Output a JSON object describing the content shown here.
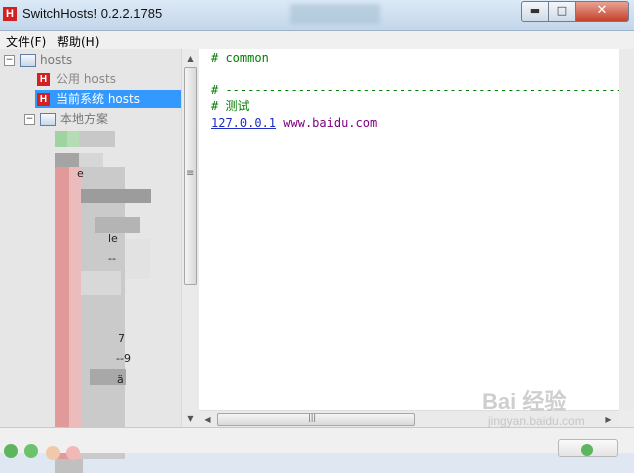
{
  "window": {
    "title": "SwitchHosts! 0.2.2.1785",
    "app_icon_letter": "H",
    "controls": {
      "minimize": "▬",
      "maximize": "□",
      "close": "✕"
    }
  },
  "menu": {
    "file": "文件(F)",
    "help": "帮助(H)"
  },
  "tree": {
    "root_label": "hosts",
    "root_expander": "−",
    "items": [
      {
        "label": "公用 hosts",
        "icon": "hosts-h-icon",
        "state": "normal"
      },
      {
        "label": "当前系统 hosts",
        "icon": "hosts-h-icon",
        "state": "selected"
      }
    ],
    "local_label": "本地方案",
    "local_expander": "−",
    "local_fragments": [
      "e",
      "le",
      "--",
      "7",
      "--9",
      "ä"
    ]
  },
  "editor": {
    "lines": [
      {
        "text": "# common",
        "kind": "comment"
      },
      {
        "text": "# ----------------------------------------------------------",
        "kind": "comment"
      },
      {
        "text": "# 测试",
        "kind": "comment"
      }
    ],
    "entry": {
      "ip": "127.0.0.1",
      "domain": "www.baidu.com"
    }
  },
  "scrollbar": {
    "grip": "≡",
    "h_grip": "|||",
    "up": "▲",
    "down": "▼",
    "left": "◀",
    "right": "▶"
  },
  "watermark": {
    "brand": "Bai 经验",
    "url": "jingyan.baidu.com"
  },
  "colors": {
    "selection": "#3399ff",
    "comment": "#008000",
    "ip": "#1e2fc1",
    "domain": "#800080",
    "app_icon": "#d42020"
  }
}
